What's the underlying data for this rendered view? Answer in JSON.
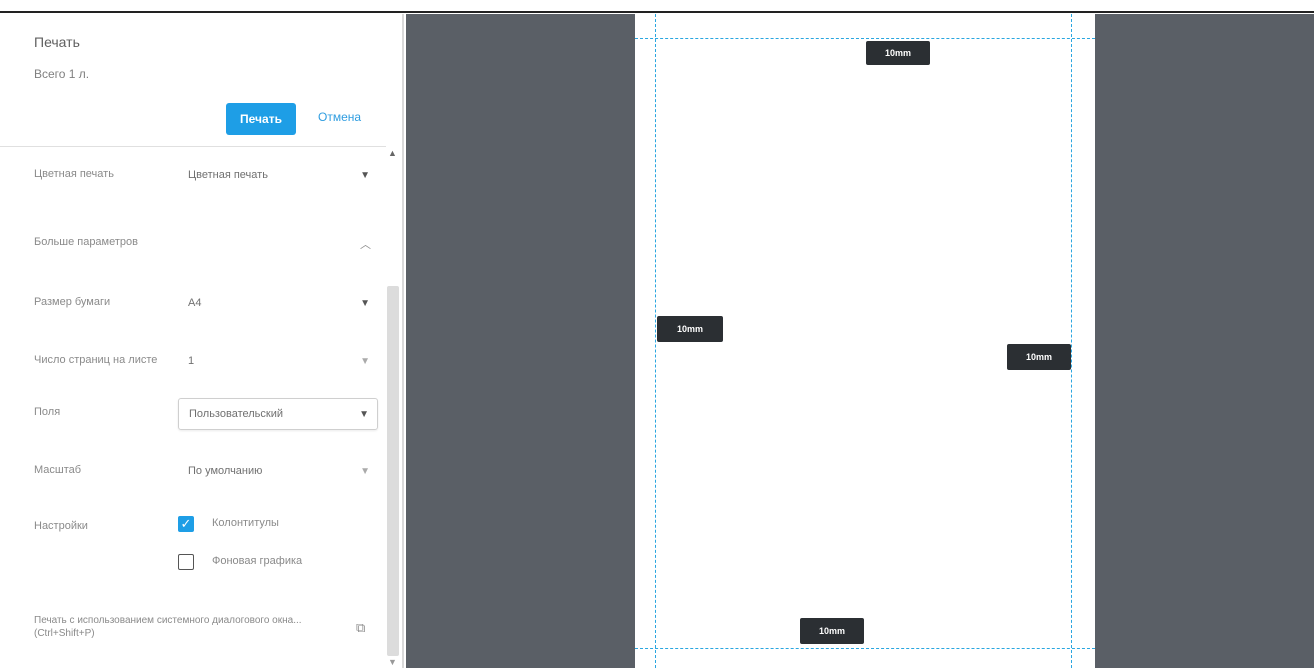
{
  "dialog": {
    "title": "Печать",
    "total": "Всего 1 л.",
    "print_button": "Печать",
    "cancel_button": "Отмена"
  },
  "settings": {
    "color": {
      "label": "Цветная печать",
      "value": "Цветная печать"
    },
    "more": {
      "label": "Больше параметров"
    },
    "paper_size": {
      "label": "Размер бумаги",
      "value": "A4"
    },
    "pages_per_sheet": {
      "label": "Число страниц на листе",
      "value": "1"
    },
    "margins": {
      "label": "Поля",
      "value": "Пользовательский"
    },
    "scale": {
      "label": "Масштаб",
      "value": "По умолчанию"
    },
    "options": {
      "label": "Настройки",
      "headers_footers": {
        "label": "Колонтитулы",
        "checked": true
      },
      "background": {
        "label": "Фоновая графика",
        "checked": false
      }
    }
  },
  "system_dialog": {
    "text": "Печать с использованием системного диалогового окна... (Ctrl+Shift+P)"
  },
  "preview": {
    "margin_top": "10mm",
    "margin_left": "10mm",
    "margin_right": "10mm",
    "margin_bottom": "10mm"
  },
  "colors": {
    "accent": "#1e9ee6",
    "preview_bg": "#5a5f66",
    "margin_guide": "#2aa6e0",
    "tag_bg": "#2b2f33"
  },
  "icons": {
    "dropdown": "chevron-down-icon",
    "collapse": "chevron-up-icon",
    "checkbox_checked": "checkmark-icon",
    "external": "external-link-icon"
  }
}
